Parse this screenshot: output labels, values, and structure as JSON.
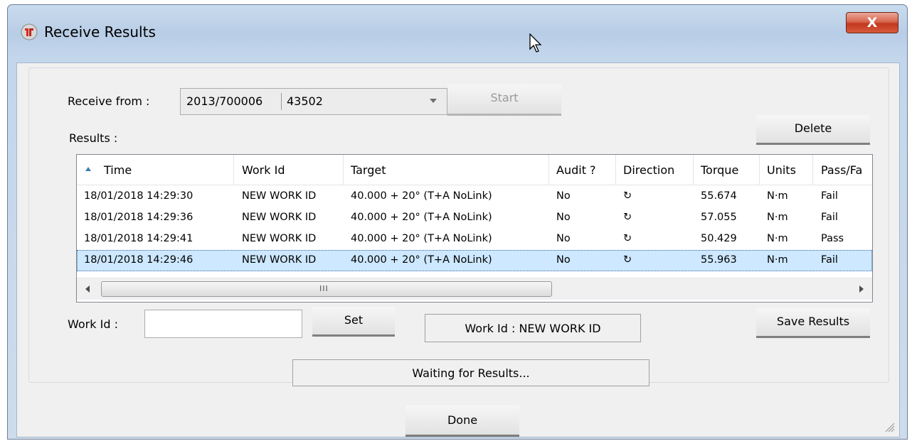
{
  "window": {
    "title": "Receive Results",
    "close_glyph": "X"
  },
  "icons": {
    "app": "receive-results-app-icon",
    "close": "close-icon",
    "cursor": "mouse-pointer-icon",
    "sort": "sort-ascending-icon",
    "direction": "clockwise-direction-icon"
  },
  "receive": {
    "label": "Receive from :",
    "combo": {
      "serial": "2013/700006",
      "id": "43502"
    },
    "start_label": "Start"
  },
  "results": {
    "label": "Results :",
    "delete_label": "Delete",
    "columns": [
      "Time",
      "Work Id",
      "Target",
      "Audit ?",
      "Direction",
      "Torque",
      "Units",
      "Pass/Fa"
    ],
    "rows": [
      {
        "time": "18/01/2018 14:29:30",
        "work_id": "NEW WORK ID",
        "target": "40.000 + 20° (T+A NoLink)",
        "audit": "No",
        "direction": "↻",
        "torque": "55.674",
        "units": "N·m",
        "pass": "Fail"
      },
      {
        "time": "18/01/2018 14:29:36",
        "work_id": "NEW WORK ID",
        "target": "40.000 + 20° (T+A NoLink)",
        "audit": "No",
        "direction": "↻",
        "torque": "57.055",
        "units": "N·m",
        "pass": "Fail"
      },
      {
        "time": "18/01/2018 14:29:41",
        "work_id": "NEW WORK ID",
        "target": "40.000 + 20° (T+A NoLink)",
        "audit": "No",
        "direction": "↻",
        "torque": "50.429",
        "units": "N·m",
        "pass": "Pass"
      },
      {
        "time": "18/01/2018 14:29:46",
        "work_id": "NEW WORK ID",
        "target": "40.000 + 20° (T+A NoLink)",
        "audit": "No",
        "direction": "↻",
        "torque": "55.963",
        "units": "N·m",
        "pass": "Fail"
      }
    ],
    "selected_row": 3,
    "scroll_grip": "III"
  },
  "workid": {
    "label": "Work Id :",
    "value": "",
    "set_label": "Set",
    "current_text": "Work Id : NEW WORK ID",
    "save_label": "Save Results"
  },
  "status": {
    "text": "Waiting for Results..."
  },
  "footer": {
    "done_label": "Done"
  },
  "colors": {
    "selection": "#cde8ff",
    "close": "#c9432a",
    "title_bar": "#b8cde6",
    "dialog": "#f0f0f0"
  }
}
